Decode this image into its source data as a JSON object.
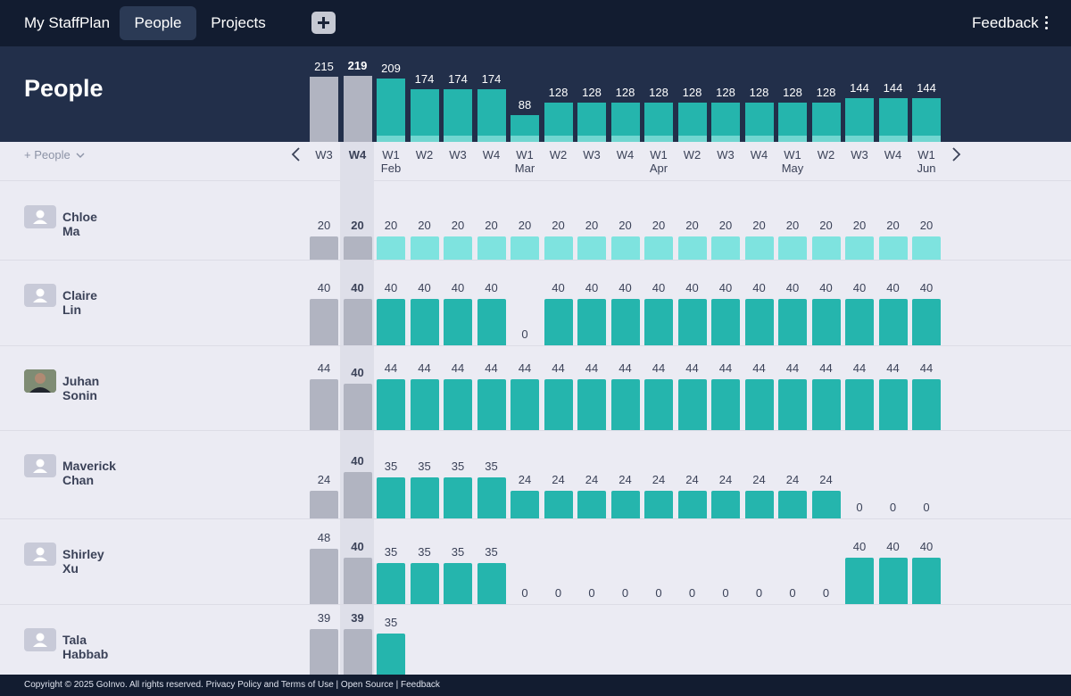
{
  "nav": {
    "brand": "My StaffPlan",
    "tabs": [
      {
        "label": "People"
      },
      {
        "label": "Projects"
      }
    ],
    "feedback": "Feedback"
  },
  "page": {
    "title": "People",
    "add_people": "+ People"
  },
  "weeks": [
    {
      "w": "W3",
      "m": ""
    },
    {
      "w": "W4",
      "m": ""
    },
    {
      "w": "W1",
      "m": "Feb"
    },
    {
      "w": "W2",
      "m": ""
    },
    {
      "w": "W3",
      "m": ""
    },
    {
      "w": "W4",
      "m": ""
    },
    {
      "w": "W1",
      "m": "Mar"
    },
    {
      "w": "W2",
      "m": ""
    },
    {
      "w": "W3",
      "m": ""
    },
    {
      "w": "W4",
      "m": ""
    },
    {
      "w": "W1",
      "m": "Apr"
    },
    {
      "w": "W2",
      "m": ""
    },
    {
      "w": "W3",
      "m": ""
    },
    {
      "w": "W4",
      "m": ""
    },
    {
      "w": "W1",
      "m": "May"
    },
    {
      "w": "W2",
      "m": ""
    },
    {
      "w": "W3",
      "m": ""
    },
    {
      "w": "W4",
      "m": ""
    },
    {
      "w": "W1",
      "m": "Jun"
    }
  ],
  "current_week_index": 1,
  "totals": [
    215,
    219,
    209,
    174,
    174,
    174,
    88,
    128,
    128,
    128,
    128,
    128,
    128,
    128,
    128,
    128,
    144,
    144,
    144
  ],
  "people": [
    {
      "name": "Chloe Ma",
      "avatar": "person-placeholder-icon",
      "hours": [
        20,
        20,
        20,
        20,
        20,
        20,
        20,
        20,
        20,
        20,
        20,
        20,
        20,
        20,
        20,
        20,
        20,
        20,
        20
      ],
      "light": true
    },
    {
      "name": "Claire Lin",
      "avatar": "person-placeholder-icon",
      "hours": [
        40,
        40,
        40,
        40,
        40,
        40,
        0,
        40,
        40,
        40,
        40,
        40,
        40,
        40,
        40,
        40,
        40,
        40,
        40
      ]
    },
    {
      "name": "Juhan Sonin",
      "avatar": "photo",
      "hours": [
        44,
        40,
        44,
        44,
        44,
        44,
        44,
        44,
        44,
        44,
        44,
        44,
        44,
        44,
        44,
        44,
        44,
        44,
        44
      ]
    },
    {
      "name": "Maverick Chan",
      "avatar": "person-placeholder-icon",
      "hours": [
        24,
        40,
        35,
        35,
        35,
        35,
        24,
        24,
        24,
        24,
        24,
        24,
        24,
        24,
        24,
        24,
        0,
        0,
        0
      ]
    },
    {
      "name": "Shirley Xu",
      "avatar": "person-placeholder-icon",
      "hours": [
        48,
        40,
        35,
        35,
        35,
        35,
        0,
        0,
        0,
        0,
        0,
        0,
        0,
        0,
        0,
        0,
        40,
        40,
        40
      ]
    },
    {
      "name": "Tala Habbab",
      "avatar": "person-placeholder-icon",
      "hours": [
        39,
        39,
        35
      ]
    }
  ],
  "colors": {
    "nav": "#121c30",
    "header": "#222f4a",
    "teal": "#25b5ad",
    "light_teal": "#7ee3df",
    "past": "#b1b4c1",
    "background": "#ebebf3"
  },
  "footer": {
    "text": "Copyright © 2025 GoInvo. All rights reserved. Privacy Policy and Terms of Use | Open Source | Feedback"
  }
}
